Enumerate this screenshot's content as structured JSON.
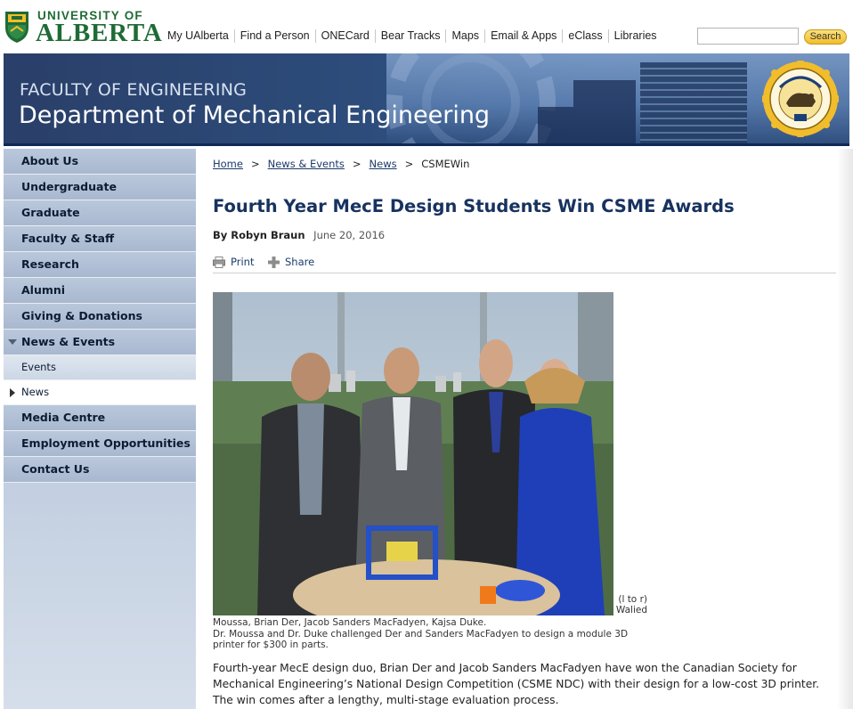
{
  "header": {
    "logo_line1": "UNIVERSITY OF",
    "logo_line2": "ALBERTA",
    "nav": [
      "My UAlberta",
      "Find a Person",
      "ONECard",
      "Bear Tracks",
      "Maps",
      "Email & Apps",
      "eClass",
      "Libraries"
    ],
    "search_value": "",
    "search_button": "Search"
  },
  "banner": {
    "faculty": "FACULTY OF ENGINEERING",
    "department": "Department of Mechanical Engineering"
  },
  "sidebar": {
    "items": [
      {
        "label": "About Us",
        "type": "top"
      },
      {
        "label": "Undergraduate",
        "type": "top"
      },
      {
        "label": "Graduate",
        "type": "top"
      },
      {
        "label": "Faculty & Staff",
        "type": "top"
      },
      {
        "label": "Research",
        "type": "top"
      },
      {
        "label": "Alumni",
        "type": "top"
      },
      {
        "label": "Giving & Donations",
        "type": "top"
      },
      {
        "label": "News & Events",
        "type": "top",
        "expanded": true
      },
      {
        "label": "Events",
        "type": "sub"
      },
      {
        "label": "News",
        "type": "sub",
        "active": true
      },
      {
        "label": "Media Centre",
        "type": "top"
      },
      {
        "label": "Employment Opportunities",
        "type": "top"
      },
      {
        "label": "Contact Us",
        "type": "top"
      }
    ]
  },
  "breadcrumb": [
    "Home",
    "News & Events",
    "News",
    "CSMEWin"
  ],
  "article": {
    "title": "Fourth Year MecE Design Students Win CSME Awards",
    "author": "By Robyn Braun",
    "date": "June 20, 2016",
    "print_label": "Print",
    "share_label": "Share",
    "caption_side_1": "(l to r)",
    "caption_side_2": "Walied",
    "caption_line1": "Moussa, Brian Der, Jacob Sanders MacFadyen, Kajsa Duke.",
    "caption_line2": "Dr. Moussa and Dr. Duke challenged Der and Sanders MacFadyen to design a module 3D printer for $300 in parts.",
    "body": "Fourth-year MecE design duo, Brian Der and Jacob Sanders MacFadyen have won the Canadian Society for Mechanical Engineering’s National Design Competition (CSME NDC) with their design for a low-cost 3D printer. The win comes after a lengthy, multi-stage evaluation process."
  },
  "colors": {
    "ua_green": "#1f6b35",
    "ua_gold": "#f2bd2c",
    "title_navy": "#17325f",
    "banner_blue": "#2d4d7c"
  },
  "icons": [
    "shield-icon",
    "seal-icon",
    "print-icon",
    "share-icon"
  ]
}
